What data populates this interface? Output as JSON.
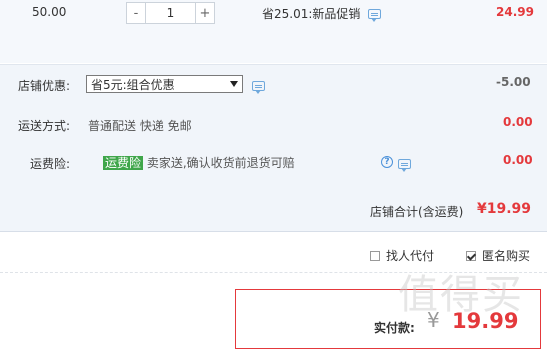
{
  "item": {
    "price": "50.00",
    "qty_minus": "-",
    "qty_value": "1",
    "qty_plus": "+",
    "promo_text": "省25.01:新品促销",
    "total": "24.99"
  },
  "shop": {
    "discount_label": "店铺优惠:",
    "discount_select": "省5元:组合优惠",
    "discount_value": "-5.00",
    "shipping_label": "运送方式:",
    "shipping_text": "普通配送 快递 免邮",
    "shipping_value": "0.00",
    "insurance_label": "运费险:",
    "insurance_tag": "运费险",
    "insurance_text": "卖家送,确认收货前退货可赔",
    "insurance_value": "0.00",
    "help_symbol": "?",
    "subtotal_label": "店铺合计(含运费)",
    "subtotal_value": "¥19.99"
  },
  "options": {
    "proxy_pay": "找人代付",
    "anonymous": "匿名购买"
  },
  "payment": {
    "label": "实付款:",
    "currency": "¥",
    "amount": "19.99"
  },
  "watermark": "值得买",
  "colors": {
    "accent_red": "#e4393c",
    "tag_green": "#3fa64a",
    "icon_blue": "#6fa8dc"
  }
}
